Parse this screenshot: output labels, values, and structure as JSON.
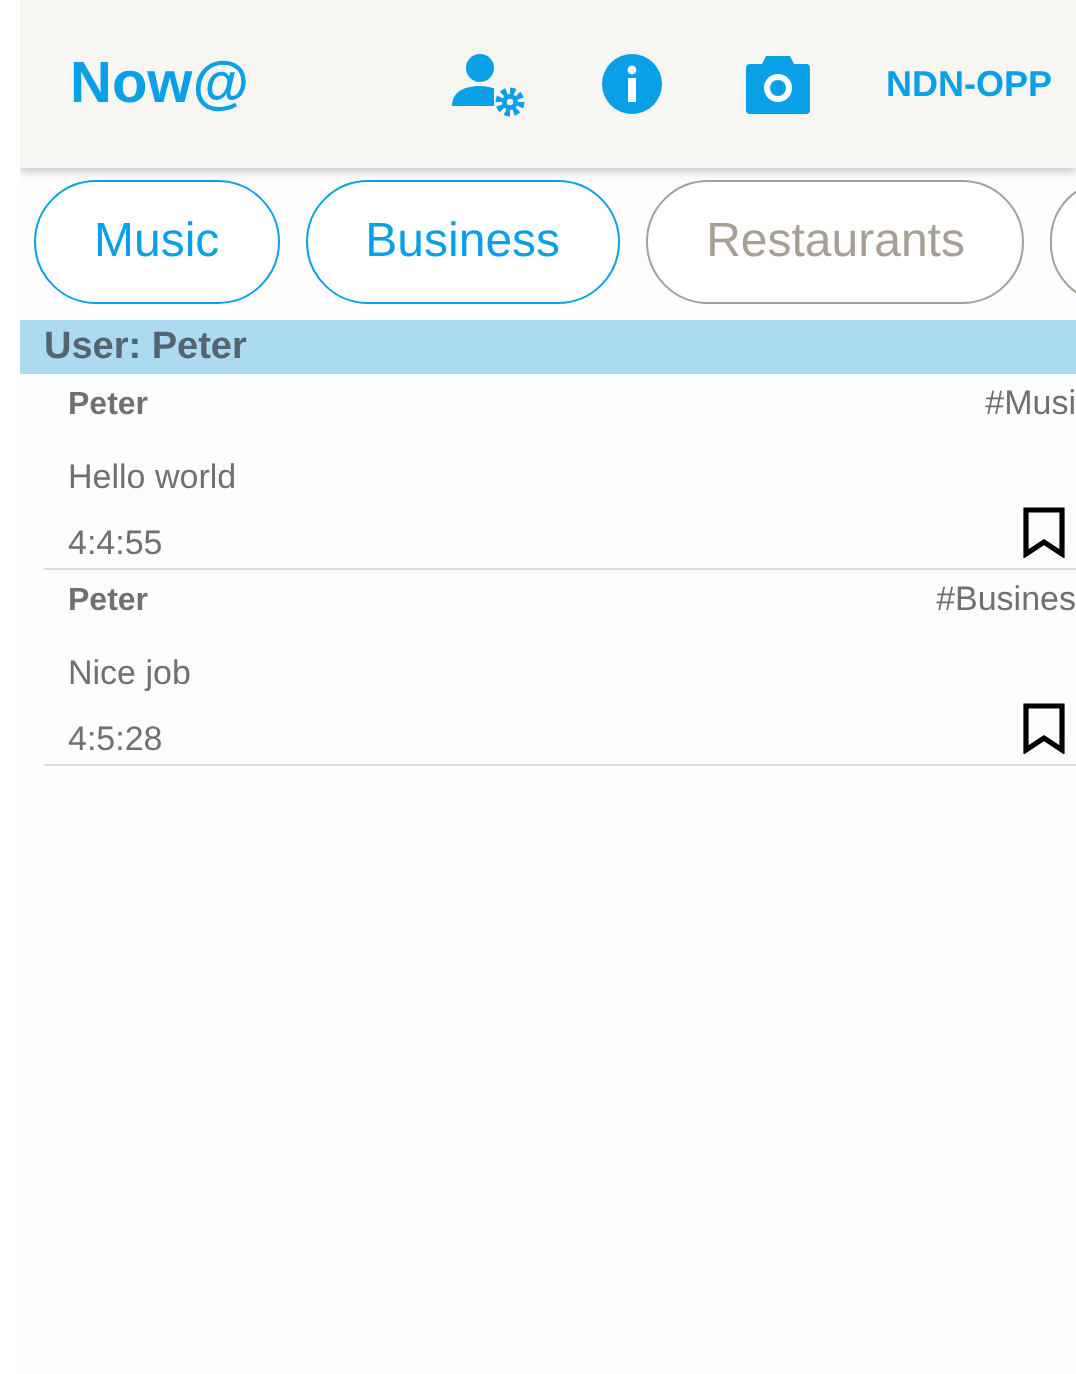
{
  "app_bar": {
    "title": "Now@",
    "action_text": "NDN-OPP"
  },
  "chips": [
    {
      "label": "Music",
      "selected": true
    },
    {
      "label": "Business",
      "selected": true
    },
    {
      "label": "Restaurants",
      "selected": false
    },
    {
      "selected": false
    }
  ],
  "user_header": "User: Peter",
  "posts": [
    {
      "author": "Peter",
      "tag": "#Musi",
      "message": "Hello world",
      "time": "4:4:55",
      "bookmarked": false
    },
    {
      "author": "Peter",
      "tag": "#Busines",
      "message": "Nice job",
      "time": "4:5:28",
      "bookmarked": false
    }
  ]
}
